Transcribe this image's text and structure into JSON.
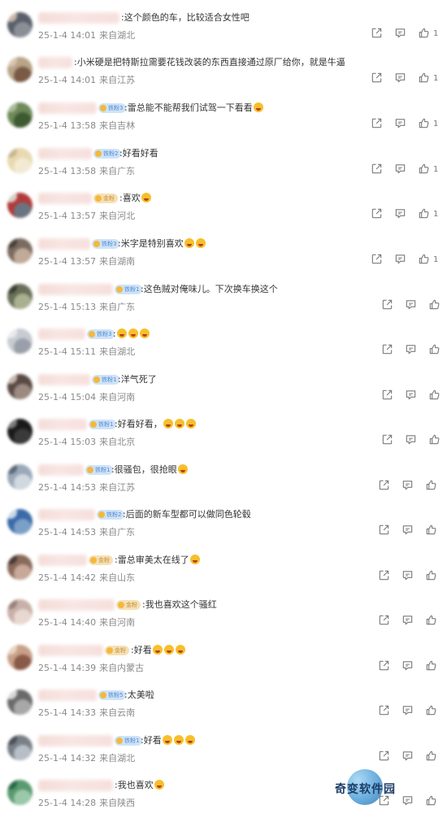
{
  "comments": [
    {
      "text": ":这个颜色的车，比较适合女性吧",
      "date": "25-1-4 14:01",
      "loc": "来自湖北",
      "likes": "1",
      "badge": "",
      "name_w": 100
    },
    {
      "text": ":小米硬是把特斯拉需要花钱改装的东西直接通过原厂给你，就是牛逼",
      "date": "25-1-4 14:01",
      "loc": "来自江苏",
      "likes": "1",
      "badge": "",
      "name_w": 42
    },
    {
      "text": ":雷总能不能帮我们试驾一下看看",
      "date": "25-1-4 13:58",
      "loc": "来自吉林",
      "likes": "1",
      "badge": "铁粉3",
      "name_w": 72
    },
    {
      "text": ":好看好看",
      "date": "25-1-4 13:58",
      "loc": "来自广东",
      "likes": "1",
      "badge": "铁粉2",
      "name_w": 66
    },
    {
      "text": ":喜欢",
      "date": "25-1-4 13:57",
      "loc": "来自河北",
      "likes": "1",
      "badge": "金粉",
      "name_w": 66
    },
    {
      "text": ":米字是特别喜欢",
      "date": "25-1-4 13:57",
      "loc": "来自湖南",
      "likes": "1",
      "badge": "铁粉3",
      "name_w": 64
    },
    {
      "text": ":这色贼对俺味儿。下次换车换这个",
      "date": "25-1-4 15:13",
      "loc": "来自广东",
      "likes": "",
      "badge": "铁粉1",
      "name_w": 92
    },
    {
      "text": ":",
      "date": "25-1-4 15:11",
      "loc": "来自湖北",
      "likes": "",
      "badge": "铁粉3",
      "name_w": 58
    },
    {
      "text": ":洋气死了",
      "date": "25-1-4 15:04",
      "loc": "来自河南",
      "likes": "",
      "badge": "铁粉1",
      "name_w": 64
    },
    {
      "text": ":好看好看，",
      "date": "25-1-4 15:03",
      "loc": "来自北京",
      "likes": "",
      "badge": "铁粉1",
      "name_w": 60
    },
    {
      "text": ":很骚包，很抢眼",
      "date": "25-1-4 14:53",
      "loc": "来自江苏",
      "likes": "",
      "badge": "铁粉1",
      "name_w": 56
    },
    {
      "text": ":后面的新车型都可以做同色轮毂",
      "date": "25-1-4 14:53",
      "loc": "来自广东",
      "likes": "",
      "badge": "铁粉2",
      "name_w": 70
    },
    {
      "text": ":雷总审美太在线了",
      "date": "25-1-4 14:42",
      "loc": "来自山东",
      "likes": "",
      "badge": "金粉",
      "name_w": 60
    },
    {
      "text": ":我也喜欢这个骚红",
      "date": "25-1-4 14:40",
      "loc": "来自河南",
      "likes": "",
      "badge": "金粉",
      "name_w": 94
    },
    {
      "text": ":好看",
      "date": "25-1-4 14:39",
      "loc": "来自内蒙古",
      "likes": "",
      "badge": "金粉",
      "name_w": 80
    },
    {
      "text": ":太美啦",
      "date": "25-1-4 14:33",
      "loc": "来自云南",
      "likes": "",
      "badge": "铁粉5",
      "name_w": 72
    },
    {
      "text": ":好看",
      "date": "25-1-4 14:32",
      "loc": "来自湖北",
      "likes": "",
      "badge": "铁粉1",
      "name_w": 92
    },
    {
      "text": ":我也喜欢",
      "date": "25-1-4 14:28",
      "loc": "来自陕西",
      "likes": "",
      "badge": "",
      "name_w": 92
    }
  ],
  "watermark": "奇变软件园",
  "icons": {
    "share": "share-icon",
    "comment": "comment-icon",
    "like": "thumbs-up-icon"
  },
  "colors": {
    "badge_blue": "#4f8ad3",
    "badge_gold": "#c79034",
    "meta": "#8a8a8a"
  }
}
